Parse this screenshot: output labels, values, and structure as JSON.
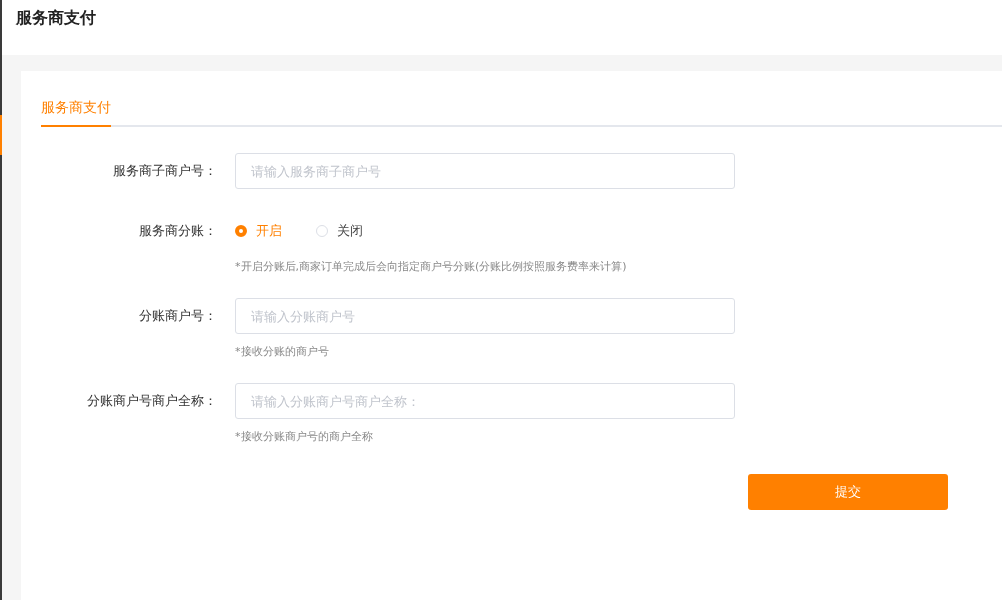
{
  "page_title": "服务商支付",
  "tabs": [
    {
      "label": "服务商支付",
      "selected": true
    }
  ],
  "fields": [
    {
      "kind": "input",
      "label": "服务商子商户号：",
      "placeholder": "请输入服务商子商户号"
    },
    {
      "kind": "radio",
      "label": "服务商分账：",
      "options": [
        {
          "label": "开启",
          "selected": true
        },
        {
          "label": "关闭",
          "selected": false
        }
      ],
      "hint": "*开启分账后,商家订单完成后会向指定商户号分账(分账比例按照服务费率来计算)"
    },
    {
      "kind": "input",
      "label": "分账商户号：",
      "placeholder": "请输入分账商户号",
      "hint": "*接收分账的商户号"
    },
    {
      "kind": "input",
      "label": "分账商户号商户全称：",
      "placeholder": "请输入分账商户号商户全称：",
      "hint": "*接收分账商户号的商户全称"
    }
  ],
  "submit": "提交"
}
